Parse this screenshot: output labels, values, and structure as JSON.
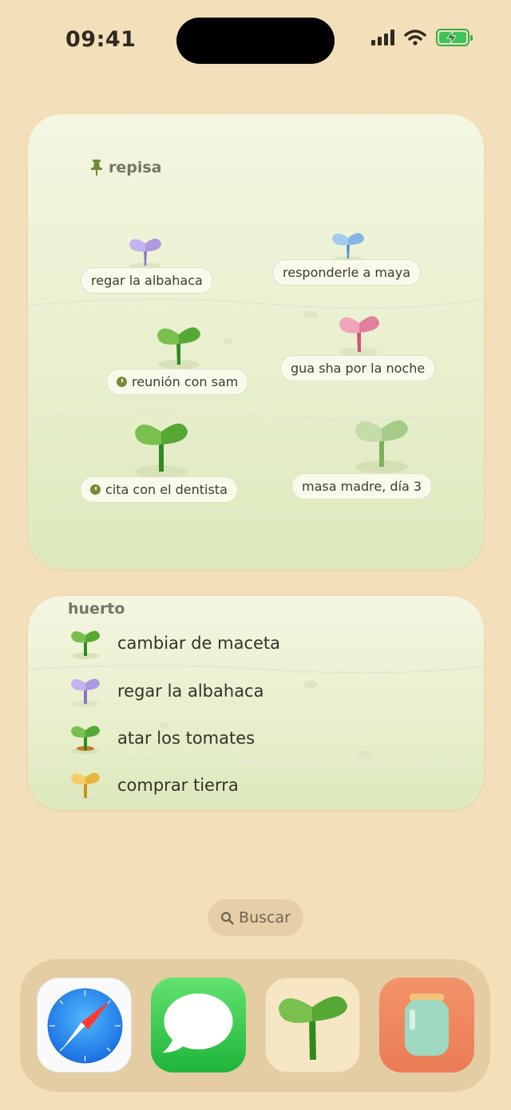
{
  "status_bar": {
    "time": "09:41"
  },
  "repisa": {
    "title": "repisa",
    "items": [
      {
        "label": "regar la albahaca",
        "color": "#b8a6e6",
        "has_clock": false
      },
      {
        "label": "responderle a maya",
        "color": "#8ebcea",
        "has_clock": false
      },
      {
        "label": "reunión con sam",
        "color": "#53a832",
        "has_clock": true
      },
      {
        "label": "gua sha por la noche",
        "color": "#eb8aa4",
        "has_clock": false
      },
      {
        "label": "cita con el dentista",
        "color": "#53a832",
        "has_clock": true
      },
      {
        "label": "masa madre, día 3",
        "color": "#a8cc8a",
        "has_clock": false
      }
    ]
  },
  "huerto": {
    "title": "huerto",
    "items": [
      {
        "label": "cambiar de maceta",
        "color": "#53a832"
      },
      {
        "label": "regar la albahaca",
        "color": "#b8a6e6"
      },
      {
        "label": "atar los tomates",
        "color": "#53a832"
      },
      {
        "label": "comprar tierra",
        "color": "#edc24e"
      }
    ]
  },
  "search": {
    "label": "Buscar"
  },
  "dock": {
    "apps": [
      {
        "icon": "safari-icon"
      },
      {
        "icon": "messages-icon"
      },
      {
        "icon": "sprout-app-icon"
      },
      {
        "icon": "jar-app-icon"
      }
    ]
  }
}
